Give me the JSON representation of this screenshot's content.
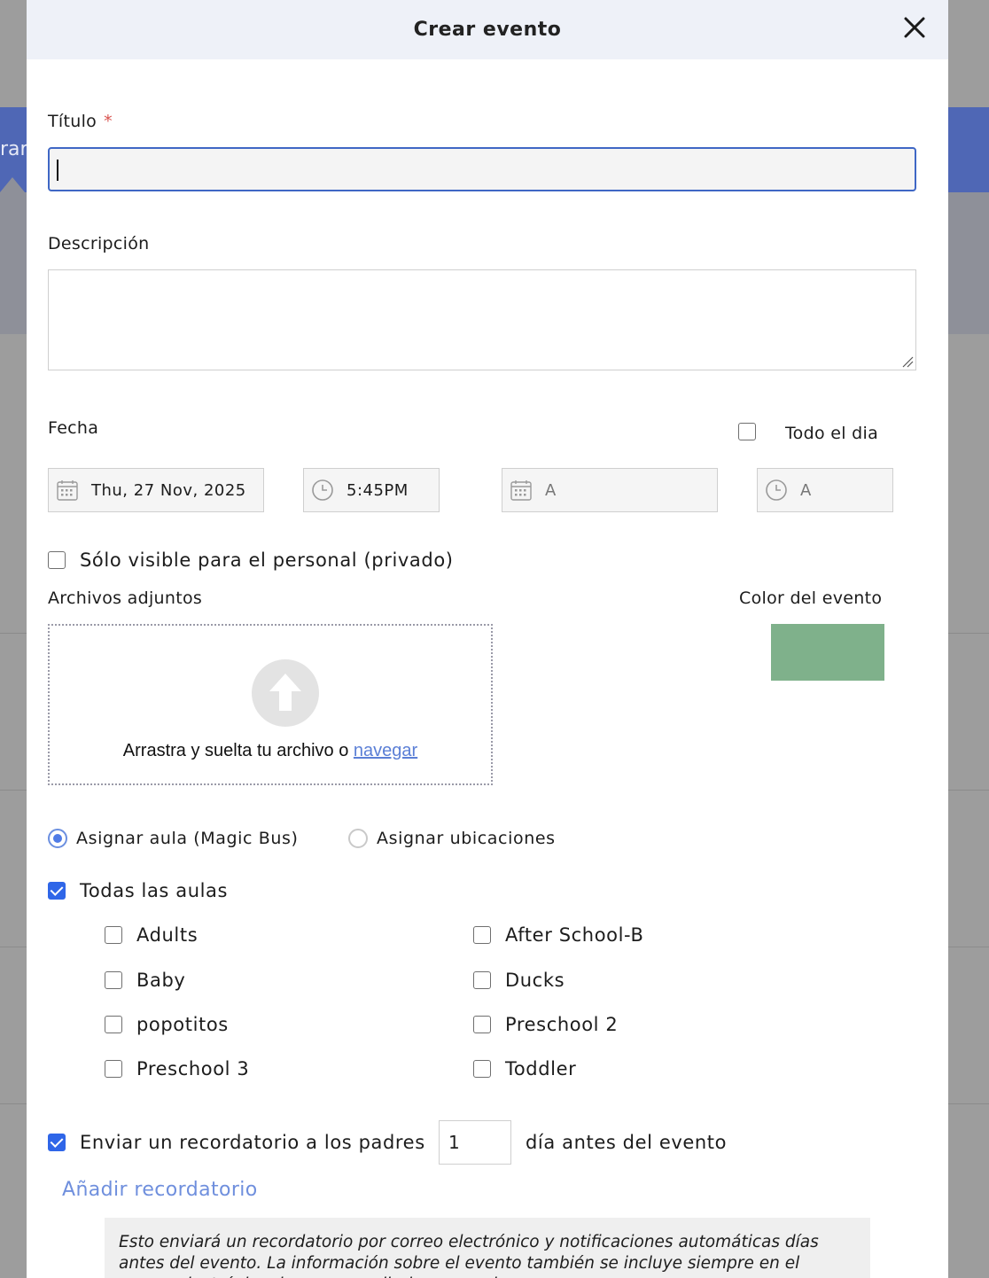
{
  "background": {
    "nav_fragment": "rar"
  },
  "modal": {
    "title": "Crear evento",
    "close_icon": "close-icon"
  },
  "form": {
    "title_label": "Título",
    "required_mark": "*",
    "title_value": "",
    "description_label": "Descripción",
    "description_value": "",
    "date_label": "Fecha",
    "all_day_label": "Todo el dia",
    "all_day_checked": false,
    "start_date": "Thu, 27 Nov, 2025",
    "start_time": "5:45PM",
    "end_date_placeholder": "A",
    "end_time_placeholder": "A",
    "private_label": "Sólo visible para el personal (privado)",
    "private_checked": false,
    "attachments_label": "Archivos adjuntos",
    "drop_text": "Arrastra y suelta tu archivo o",
    "browse_link": "navegar",
    "event_color_label": "Color del evento",
    "event_color": "#7fb18b",
    "assign_options": [
      {
        "label": "Asignar aula (Magic Bus)",
        "selected": true
      },
      {
        "label": "Asignar ubicaciones",
        "selected": false
      }
    ],
    "all_classes_label": "Todas las aulas",
    "all_classes_checked": true,
    "classes": [
      {
        "label": "Adults",
        "checked": false
      },
      {
        "label": "After School-B",
        "checked": false
      },
      {
        "label": "Baby",
        "checked": false
      },
      {
        "label": "Ducks",
        "checked": false
      },
      {
        "label": "popotitos",
        "checked": false
      },
      {
        "label": "Preschool 2",
        "checked": false
      },
      {
        "label": "Preschool 3",
        "checked": false
      },
      {
        "label": "Toddler",
        "checked": false
      }
    ],
    "reminder_checked": true,
    "reminder_prefix": "Enviar un recordatorio a los padres",
    "reminder_days": "1",
    "reminder_suffix": "día antes del evento",
    "add_reminder": "Añadir recordatorio",
    "note": "Esto enviará un recordatorio por correo electrónico y notificaciones automáticas días antes del evento. La información sobre el evento también se incluye siempre en el correo electrónico de resumen diario semanal."
  },
  "colors": {
    "accent": "#2f66e8",
    "link": "#6f8fdd",
    "header_bg": "#eef1f8"
  }
}
